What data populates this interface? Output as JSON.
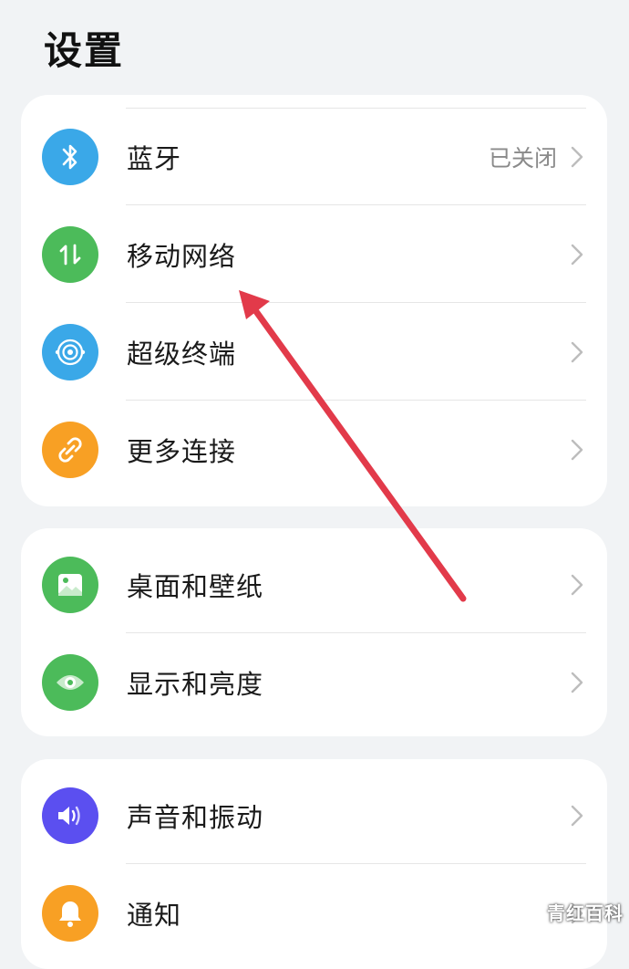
{
  "page": {
    "title": "设置"
  },
  "groups": [
    {
      "items": [
        {
          "label": "蓝牙",
          "value": "已关闭",
          "icon": "bluetooth-icon",
          "color": "#3aa8e8"
        },
        {
          "label": "移动网络",
          "value": "",
          "icon": "mobile-data-icon",
          "color": "#4cbb5a"
        },
        {
          "label": "超级终端",
          "value": "",
          "icon": "super-device-icon",
          "color": "#3aa8e8"
        },
        {
          "label": "更多连接",
          "value": "",
          "icon": "link-icon",
          "color": "#f8a024"
        }
      ]
    },
    {
      "items": [
        {
          "label": "桌面和壁纸",
          "value": "",
          "icon": "wallpaper-icon",
          "color": "#4cbb5a"
        },
        {
          "label": "显示和亮度",
          "value": "",
          "icon": "eye-icon",
          "color": "#4cbb5a"
        }
      ]
    },
    {
      "items": [
        {
          "label": "声音和振动",
          "value": "",
          "icon": "speaker-icon",
          "color": "#5b4ff0"
        },
        {
          "label": "通知",
          "value": "",
          "icon": "bell-icon",
          "color": "#f8a024"
        }
      ]
    }
  ],
  "annotation": {
    "arrow_color": "#e23a4a"
  },
  "watermark": {
    "text": "青红百科"
  }
}
